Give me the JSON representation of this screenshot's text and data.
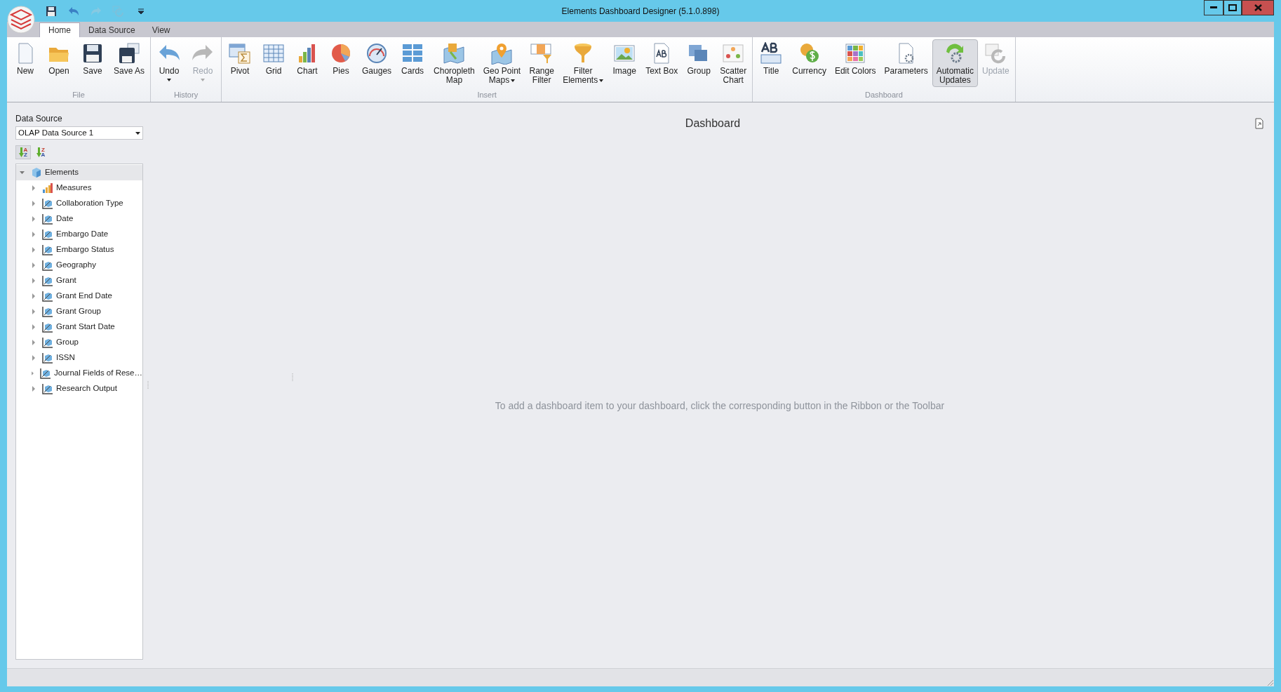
{
  "window": {
    "title": "Elements Dashboard Designer (5.1.0.898)"
  },
  "quick_access": [
    {
      "kind": "save",
      "disabled": false
    },
    {
      "kind": "undo",
      "disabled": false
    },
    {
      "kind": "redo",
      "disabled": true
    },
    {
      "kind": "refresh",
      "disabled": true
    },
    {
      "kind": "customize",
      "disabled": false
    }
  ],
  "tabs": [
    {
      "label": "Home",
      "selected": true
    },
    {
      "label": "Data Source",
      "selected": false
    },
    {
      "label": "View",
      "selected": false
    }
  ],
  "ribbon": {
    "groups": [
      {
        "label": "File",
        "buttons": [
          {
            "kind": "new",
            "lines": [
              "New"
            ],
            "disabled": false,
            "dropdown": false,
            "checked": false
          },
          {
            "kind": "open",
            "lines": [
              "Open"
            ],
            "disabled": false,
            "dropdown": false,
            "checked": false
          },
          {
            "kind": "save",
            "lines": [
              "Save"
            ],
            "disabled": false,
            "dropdown": false,
            "checked": false
          },
          {
            "kind": "saveas",
            "lines": [
              "Save As"
            ],
            "disabled": false,
            "dropdown": false,
            "checked": false
          }
        ]
      },
      {
        "label": "History",
        "buttons": [
          {
            "kind": "undo",
            "lines": [
              "Undo"
            ],
            "disabled": false,
            "dropdown": true,
            "checked": false
          },
          {
            "kind": "redo",
            "lines": [
              "Redo"
            ],
            "disabled": true,
            "dropdown": true,
            "checked": false
          }
        ]
      },
      {
        "label": "Insert",
        "buttons": [
          {
            "kind": "pivot",
            "lines": [
              "Pivot"
            ],
            "disabled": false,
            "dropdown": false,
            "checked": false
          },
          {
            "kind": "grid",
            "lines": [
              "Grid"
            ],
            "disabled": false,
            "dropdown": false,
            "checked": false
          },
          {
            "kind": "chart",
            "lines": [
              "Chart"
            ],
            "disabled": false,
            "dropdown": false,
            "checked": false
          },
          {
            "kind": "pie",
            "lines": [
              "Pies"
            ],
            "disabled": false,
            "dropdown": false,
            "checked": false
          },
          {
            "kind": "gauge",
            "lines": [
              "Gauges"
            ],
            "disabled": false,
            "dropdown": false,
            "checked": false
          },
          {
            "kind": "cards",
            "lines": [
              "Cards"
            ],
            "disabled": false,
            "dropdown": false,
            "checked": false
          },
          {
            "kind": "map",
            "lines": [
              "Choropleth",
              "Map"
            ],
            "disabled": false,
            "dropdown": false,
            "checked": false
          },
          {
            "kind": "pin",
            "lines": [
              "Geo Point",
              "Maps"
            ],
            "disabled": false,
            "dropdown": true,
            "checked": false
          },
          {
            "kind": "range",
            "lines": [
              "Range",
              "Filter"
            ],
            "disabled": false,
            "dropdown": false,
            "checked": false
          },
          {
            "kind": "funnel",
            "lines": [
              "Filter",
              "Elements"
            ],
            "disabled": false,
            "dropdown": true,
            "checked": false
          },
          {
            "kind": "image",
            "lines": [
              "Image"
            ],
            "disabled": false,
            "dropdown": false,
            "checked": false
          },
          {
            "kind": "textbox",
            "lines": [
              "Text Box"
            ],
            "disabled": false,
            "dropdown": false,
            "checked": false
          },
          {
            "kind": "group",
            "lines": [
              "Group"
            ],
            "disabled": false,
            "dropdown": false,
            "checked": false
          },
          {
            "kind": "scatter",
            "lines": [
              "Scatter",
              "Chart"
            ],
            "disabled": false,
            "dropdown": false,
            "checked": false
          }
        ]
      },
      {
        "label": "Dashboard",
        "buttons": [
          {
            "kind": "title",
            "lines": [
              "Title"
            ],
            "disabled": false,
            "dropdown": false,
            "checked": false
          },
          {
            "kind": "currency",
            "lines": [
              "Currency"
            ],
            "disabled": false,
            "dropdown": false,
            "checked": false
          },
          {
            "kind": "colors",
            "lines": [
              "Edit Colors"
            ],
            "disabled": false,
            "dropdown": false,
            "checked": false
          },
          {
            "kind": "params",
            "lines": [
              "Parameters"
            ],
            "disabled": false,
            "dropdown": false,
            "checked": false
          },
          {
            "kind": "auto",
            "lines": [
              "Automatic",
              "Updates"
            ],
            "disabled": false,
            "dropdown": false,
            "checked": true
          },
          {
            "kind": "update",
            "lines": [
              "Update"
            ],
            "disabled": true,
            "dropdown": false,
            "checked": false
          }
        ]
      }
    ]
  },
  "data_source": {
    "label": "Data Source",
    "value": "OLAP Data Source 1"
  },
  "sort_buttons": [
    {
      "top": "A",
      "bottom": "Z",
      "selected": true
    },
    {
      "top": "Z",
      "bottom": "A",
      "selected": false
    }
  ],
  "tree": [
    {
      "label": "Elements",
      "kind": "cube",
      "expanded": true,
      "selected": true,
      "children": [
        {
          "label": "Measures",
          "kind": "measure",
          "expanded": false,
          "selected": false
        },
        {
          "label": "Collaboration Type",
          "kind": "dimension",
          "expanded": false,
          "selected": false
        },
        {
          "label": "Date",
          "kind": "dimension",
          "expanded": false,
          "selected": false
        },
        {
          "label": "Embargo Date",
          "kind": "dimension",
          "expanded": false,
          "selected": false
        },
        {
          "label": "Embargo Status",
          "kind": "dimension",
          "expanded": false,
          "selected": false
        },
        {
          "label": "Geography",
          "kind": "dimension",
          "expanded": false,
          "selected": false
        },
        {
          "label": "Grant",
          "kind": "dimension",
          "expanded": false,
          "selected": false
        },
        {
          "label": "Grant End Date",
          "kind": "dimension",
          "expanded": false,
          "selected": false
        },
        {
          "label": "Grant Group",
          "kind": "dimension",
          "expanded": false,
          "selected": false
        },
        {
          "label": "Grant Start Date",
          "kind": "dimension",
          "expanded": false,
          "selected": false
        },
        {
          "label": "Group",
          "kind": "dimension",
          "expanded": false,
          "selected": false
        },
        {
          "label": "ISSN",
          "kind": "dimension",
          "expanded": false,
          "selected": false
        },
        {
          "label": "Journal Fields of Rese…",
          "kind": "dimension",
          "expanded": false,
          "selected": false
        },
        {
          "label": "Research Output",
          "kind": "dimension",
          "expanded": false,
          "selected": false
        }
      ]
    }
  ],
  "dashboard": {
    "title": "Dashboard",
    "hint": "To add a dashboard item to your dashboard, click the corresponding button in the Ribbon or the Toolbar"
  }
}
